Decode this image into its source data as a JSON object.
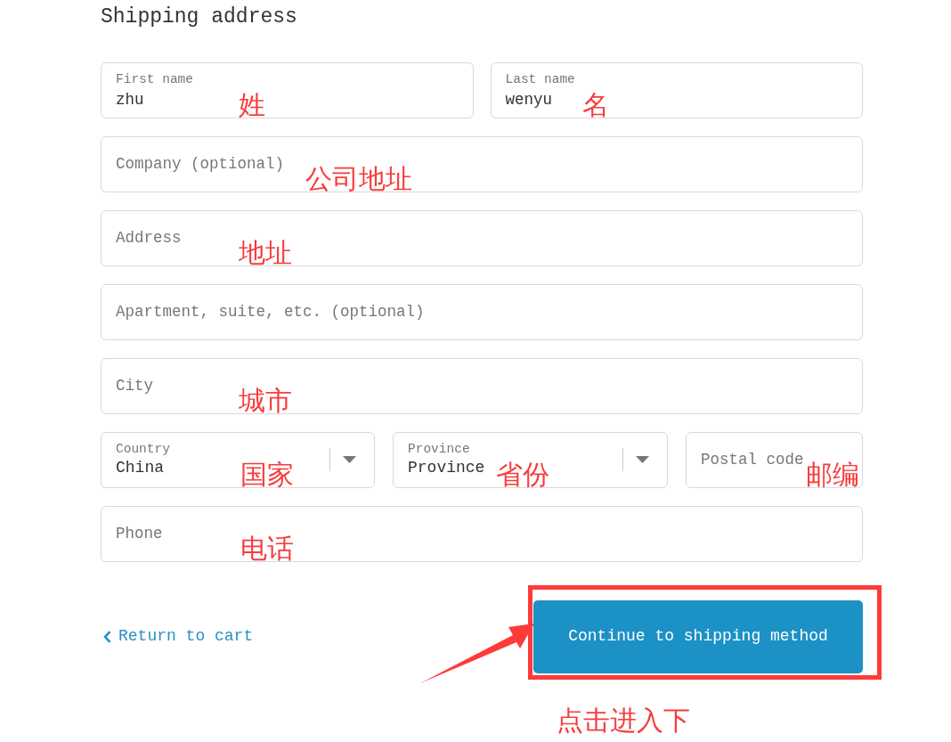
{
  "heading": "Shipping address",
  "rows": [
    [
      {
        "kind": "text",
        "label": "First name",
        "value": "zhu",
        "annotation": "姓"
      },
      {
        "kind": "text",
        "label": "Last name",
        "value": "wenyu",
        "annotation": "名"
      }
    ],
    [
      {
        "kind": "text",
        "placeholder": "Company (optional)",
        "annotation": "公司地址"
      }
    ],
    [
      {
        "kind": "text",
        "placeholder": "Address",
        "annotation": "地址"
      }
    ],
    [
      {
        "kind": "text",
        "placeholder": "Apartment, suite, etc. (optional)"
      }
    ],
    [
      {
        "kind": "text",
        "placeholder": "City",
        "annotation": "城市"
      }
    ],
    [
      {
        "kind": "select",
        "label": "Country",
        "value": "China",
        "annotation": "国家"
      },
      {
        "kind": "select",
        "label": "Province",
        "value": "Province",
        "annotation": "省份"
      },
      {
        "kind": "text",
        "placeholder": "Postal code",
        "annotation": "邮编"
      }
    ],
    [
      {
        "kind": "text",
        "placeholder": "Phone",
        "annotation": "电话"
      }
    ]
  ],
  "actions": {
    "return_link": "Return to cart",
    "continue_button": "Continue to shipping method",
    "button_note": "点击进入下"
  }
}
